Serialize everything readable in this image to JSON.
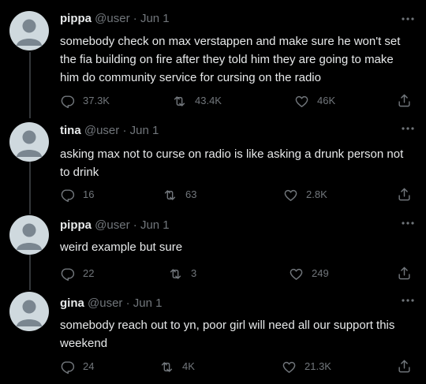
{
  "colors": {
    "background": "#000000",
    "text": "#e7e9ea",
    "muted": "#71767b",
    "thread_line": "#333639",
    "avatar": "#cfd9de"
  },
  "icons": {
    "more": "more-horizontal-icon",
    "reply": "reply-icon",
    "retweet": "retweet-icon",
    "like": "like-icon",
    "share": "share-icon"
  },
  "tweets": [
    {
      "name": "pippa",
      "handle": "@user",
      "separator": "·",
      "date": "Jun 1",
      "text": "somebody check on max verstappen and make sure he won't set the fia building on fire after they told him they are going to make him do community service for cursing on the radio",
      "replies": "37.3K",
      "retweets": "43.4K",
      "likes": "46K"
    },
    {
      "name": "tina",
      "handle": "@user",
      "separator": "·",
      "date": "Jun 1",
      "text": "asking max not to curse on radio is like asking a drunk person not to drink",
      "replies": "16",
      "retweets": "63",
      "likes": "2.8K"
    },
    {
      "name": "pippa",
      "handle": "@user",
      "separator": "·",
      "date": "Jun 1",
      "text": "weird example but sure",
      "replies": "22",
      "retweets": "3",
      "likes": "249"
    },
    {
      "name": "gina",
      "handle": "@user",
      "separator": "·",
      "date": "Jun 1",
      "text": "somebody reach out to yn, poor girl will need all our support this weekend",
      "replies": "24",
      "retweets": "4K",
      "likes": "21.3K"
    }
  ]
}
